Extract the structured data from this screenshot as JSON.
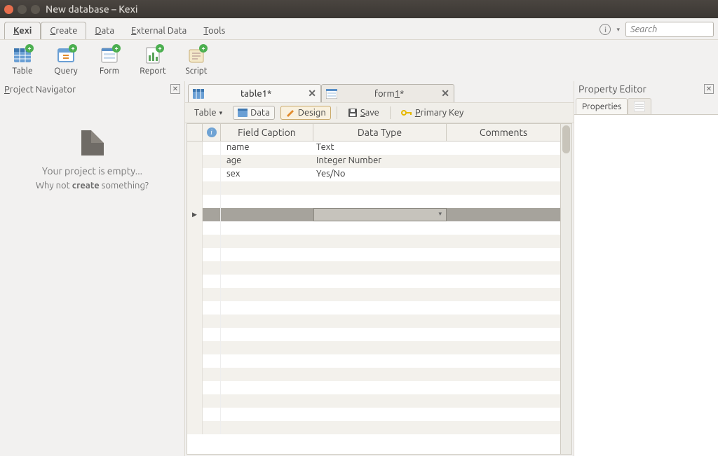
{
  "window": {
    "title": "New database – Kexi"
  },
  "menubar": {
    "tabs": [
      "Kexi",
      "Create",
      "Data",
      "External Data",
      "Tools"
    ],
    "search_placeholder": "Search"
  },
  "toolbar": {
    "items": [
      {
        "label": "Table"
      },
      {
        "label": "Query"
      },
      {
        "label": "Form"
      },
      {
        "label": "Report"
      },
      {
        "label": "Script"
      }
    ]
  },
  "navigator": {
    "title": "Project Navigator",
    "empty_line1": "Your project is empty...",
    "empty_line2_pre": "Why not ",
    "empty_line2_bold": "create",
    "empty_line2_post": " something?"
  },
  "doc_tabs": [
    {
      "label": "table1*",
      "type": "table",
      "active": true
    },
    {
      "label": "form1*",
      "type": "form",
      "active": false
    }
  ],
  "subtoolbar": {
    "dropdown": "Table",
    "data": "Data",
    "design": "Design",
    "save": "Save",
    "primary_key": "Primary Key"
  },
  "grid": {
    "headers": {
      "c1": "Field Caption",
      "c2": "Data Type",
      "c3": "Comments"
    },
    "rows": [
      {
        "caption": "name",
        "type": "Text",
        "comments": ""
      },
      {
        "caption": "age",
        "type": "Integer Number",
        "comments": ""
      },
      {
        "caption": "sex",
        "type": "Yes/No",
        "comments": ""
      }
    ],
    "selected_row_index": 5
  },
  "property_editor": {
    "title": "Property Editor",
    "tab_properties": "Properties"
  }
}
